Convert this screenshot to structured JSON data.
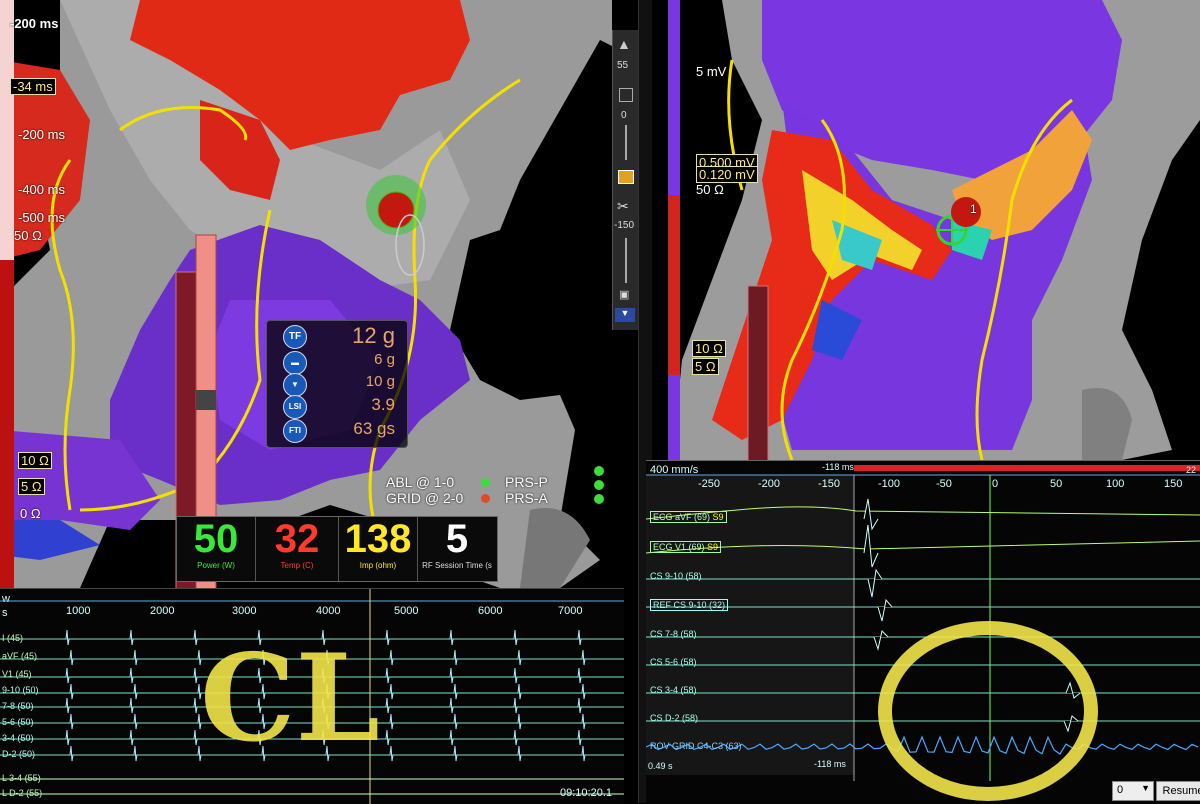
{
  "left_map": {
    "scale_labels": [
      "-200 ms",
      "-34 ms",
      "-200 ms",
      "-400 ms",
      "-500 ms",
      "50 Ω"
    ],
    "ohm_labels": [
      "10 Ω",
      "5 Ω",
      "0 Ω"
    ],
    "toolbar": {
      "value_top": "55",
      "value_mid": "0",
      "value_low": "-150"
    },
    "force_panel": [
      {
        "icon": "TF",
        "value": "12 g"
      },
      {
        "icon": "",
        "value": "6 g"
      },
      {
        "icon": "",
        "value": "10 g"
      },
      {
        "icon": "LSI",
        "value": "3.9"
      },
      {
        "icon": "FTI",
        "value": "63 gs"
      }
    ],
    "legend": [
      {
        "label": "ABL @ 1-0",
        "color": "#3ddc3d"
      },
      {
        "label": "GRID @ 2-0",
        "color": "#e04a2a"
      }
    ],
    "legend_right": [
      {
        "label": "PRS-P",
        "color": "#3ddc3d"
      },
      {
        "label": "PRS-A",
        "color": "#e04a2a"
      }
    ]
  },
  "rf_panel": {
    "power": {
      "value": "50",
      "caption": "Power (W)",
      "color": "#39e83a"
    },
    "temp": {
      "value": "32",
      "caption": "Temp (C)",
      "color": "#ff3b2e"
    },
    "imp": {
      "value": "138",
      "caption": "Imp (ohm)",
      "color": "#ffe82a"
    },
    "session": {
      "value": "5",
      "caption": "RF Session Time (s",
      "color": "#ffffff"
    }
  },
  "left_ecg": {
    "corner": "w",
    "unit": "s",
    "ticks": [
      "1000",
      "2000",
      "3000",
      "4000",
      "5000",
      "6000",
      "7000"
    ],
    "channels": [
      "I (45)",
      "aVF (45)",
      "V1 (45)",
      "9-10 (50)",
      "7-8 (50)",
      "5-6 (50)",
      "3-4 (50)",
      "D-2 (50)",
      "L 3-4 (55)",
      "L D-2 (55)"
    ],
    "timestamp": "09:10:20.1"
  },
  "right_map": {
    "mv_top": "5 mV",
    "mv_values": [
      "0.500 mV",
      "0.120 mV"
    ],
    "ohm_top": "50 Ω",
    "ohm_labels": [
      "10 Ω",
      "5 Ω"
    ],
    "marker": "1"
  },
  "right_ecg": {
    "speed": "400 mm/s",
    "offset_top": "-118 ms",
    "ticks": [
      "-250",
      "-200",
      "-150",
      "-100",
      "-50",
      "0",
      "50",
      "100",
      "150"
    ],
    "edge_tick": "22",
    "channels": [
      {
        "label": "ECG aVF (69)",
        "suffix": "S9",
        "boxed": true
      },
      {
        "label": "ECG V1 (69)",
        "suffix": "S9",
        "boxed": true
      },
      {
        "label": "CS  9-10 (58)",
        "suffix": "",
        "boxed": false
      },
      {
        "label": "REF CS  9-10 (32)",
        "suffix": "",
        "boxed": true
      },
      {
        "label": "CS  7-8 (58)",
        "suffix": "",
        "boxed": false
      },
      {
        "label": "CS  5-6 (58)",
        "suffix": "",
        "boxed": false
      },
      {
        "label": "CS  3-4 (58)",
        "suffix": "",
        "boxed": false
      },
      {
        "label": "CS  D-2 (58)",
        "suffix": "",
        "boxed": false
      },
      {
        "label": "ROV GRID  C4-C3 (63)",
        "suffix": "",
        "boxed": false
      }
    ],
    "bottom_left": "0.49 s",
    "bottom_offset": "-118 ms",
    "select_value": "0",
    "resume_label": "Resume"
  },
  "annotations": {
    "handwritten": "CL"
  }
}
